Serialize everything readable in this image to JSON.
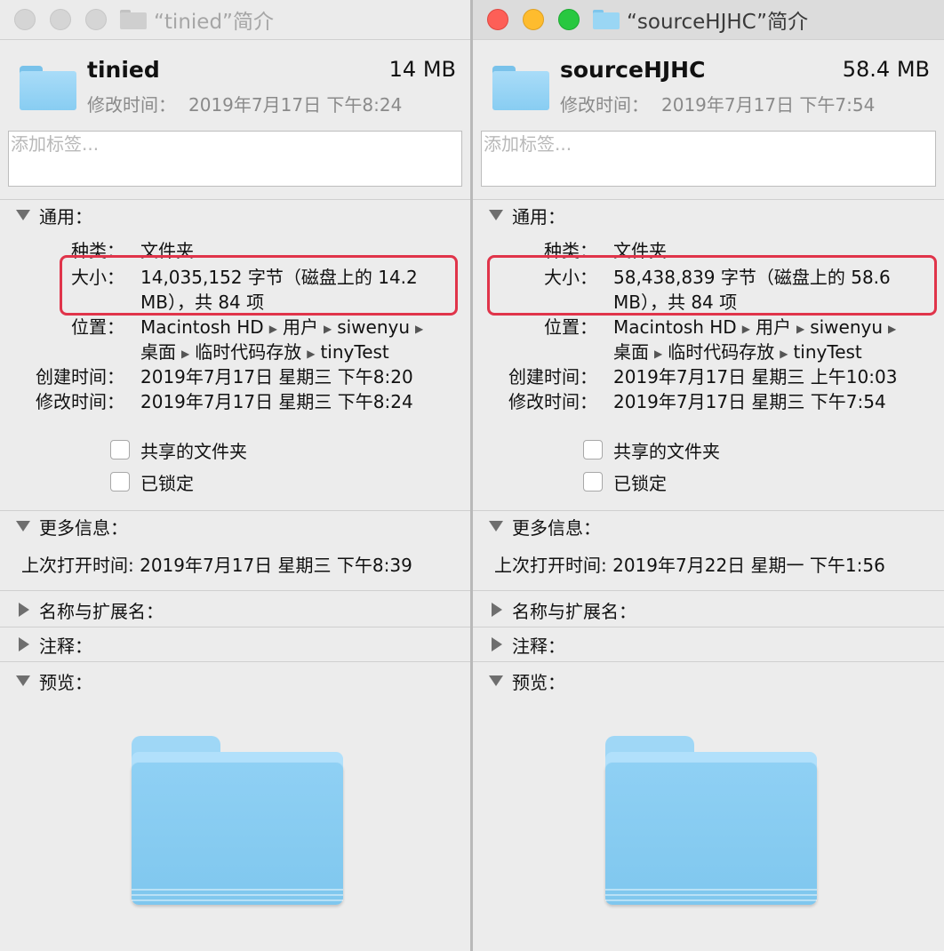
{
  "windows": [
    {
      "active": false,
      "title": "“tinied”简介",
      "name": "tinied",
      "size": "14 MB",
      "modified_label": "修改时间：",
      "modified_value": "2019年7月17日 下午8:24",
      "tags_placeholder": "添加标签...",
      "general": {
        "title": "通用：",
        "kind_label": "种类：",
        "kind": "文件夹",
        "size_label": "大小：",
        "size_line1": "14,035,152 字节（磁盘上的 14.2",
        "size_line2": "MB），共 84 项",
        "where_label": "位置：",
        "where_path1": [
          "Macintosh HD",
          "用户",
          "siwenyu",
          ""
        ],
        "where_path2": [
          "桌面",
          "临时代码存放",
          "tinyTest"
        ],
        "created_label": "创建时间：",
        "created": "2019年7月17日 星期三 下午8:20",
        "modified_label2": "修改时间：",
        "modified": "2019年7月17日 星期三 下午8:24",
        "shared_folder": "共享的文件夹",
        "locked": "已锁定"
      },
      "more_info": {
        "title": "更多信息：",
        "last_opened": "上次打开时间: 2019年7月17日 星期三 下午8:39"
      },
      "name_ext": "名称与扩展名：",
      "comments": "注释：",
      "preview": "预览："
    },
    {
      "active": true,
      "title": "“sourceHJHC”简介",
      "name": "sourceHJHC",
      "size": "58.4 MB",
      "modified_label": "修改时间：",
      "modified_value": "2019年7月17日 下午7:54",
      "tags_placeholder": "添加标签...",
      "general": {
        "title": "通用：",
        "kind_label": "种类：",
        "kind": "文件夹",
        "size_label": "大小：",
        "size_line1": "58,438,839 字节（磁盘上的 58.6",
        "size_line2": "MB），共 84 项",
        "where_label": "位置：",
        "where_path1": [
          "Macintosh HD",
          "用户",
          "siwenyu",
          ""
        ],
        "where_path2": [
          "桌面",
          "临时代码存放",
          "tinyTest"
        ],
        "created_label": "创建时间：",
        "created": "2019年7月17日 星期三 上午10:03",
        "modified_label2": "修改时间：",
        "modified": "2019年7月17日 星期三 下午7:54",
        "shared_folder": "共享的文件夹",
        "locked": "已锁定"
      },
      "more_info": {
        "title": "更多信息：",
        "last_opened": "上次打开时间: 2019年7月22日 星期一 下午1:56"
      },
      "name_ext": "名称与扩展名：",
      "comments": "注释：",
      "preview": "预览："
    }
  ],
  "colors": {
    "highlight": "#e0344a",
    "folder": "#88cdf2"
  }
}
